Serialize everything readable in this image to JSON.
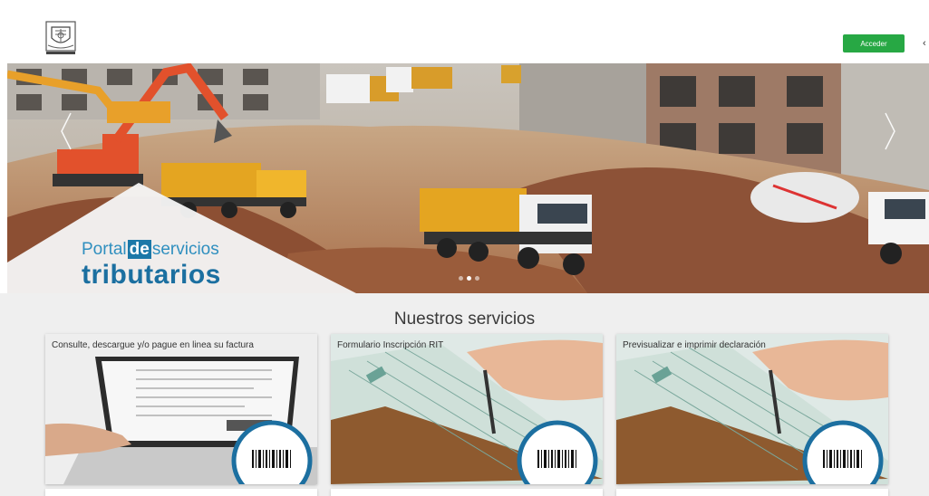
{
  "header": {
    "logo_icon": "municipal-shield-logo",
    "login_label": "Acceder",
    "accent_color": "#27a844"
  },
  "hero": {
    "brand_prefix": "Portal",
    "brand_de": "de",
    "brand_suffix": "servicios",
    "brand_main": "tributarios",
    "prev_icon": "chevron-left-icon",
    "next_icon": "chevron-right-icon",
    "slide_count": 3,
    "active_slide": 2,
    "brand_color": "#1b78a8"
  },
  "services": {
    "title": "Nuestros servicios",
    "cards": [
      {
        "label": "Consulte, descargue y/o pague en linea su factura",
        "icon": "barcode-icon"
      },
      {
        "label": "Formulario Inscripción RIT",
        "icon": "barcode-icon"
      },
      {
        "label": "Previsualizar e imprimir declaración",
        "icon": "barcode-icon"
      }
    ]
  }
}
